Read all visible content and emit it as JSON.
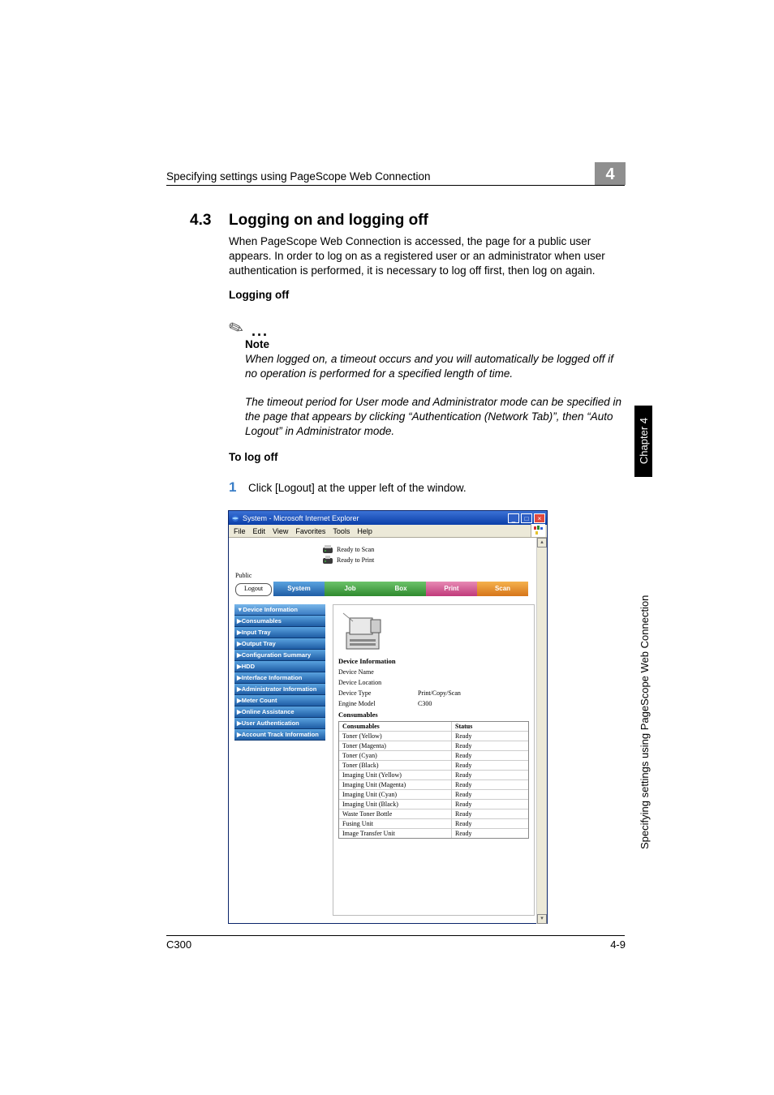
{
  "header": {
    "running_head": "Specifying settings using PageScope Web Connection",
    "chapter_badge": "4"
  },
  "section": {
    "number": "4.3",
    "title": "Logging on and logging off",
    "intro": "When PageScope Web Connection is accessed, the page for a public user appears. In order to log on as a registered user or an administrator when user authentication is performed, it is necessary to log off first, then log on again.",
    "sub1": "Logging off",
    "note_label": "Note",
    "note1": "When logged on, a timeout occurs and you will automatically be logged off if no operation is performed for a specified length of time.",
    "note2": "The timeout period for User mode and Administrator mode can be specified in the page that appears by clicking “Authentication (Network Tab)”, then “Auto Logout” in Administrator mode.",
    "sub2": "To log off",
    "step_num": "1",
    "step_text": "Click [Logout] at the upper left of the window."
  },
  "window": {
    "title": "System - Microsoft Internet Explorer",
    "menu": [
      "File",
      "Edit",
      "View",
      "Favorites",
      "Tools",
      "Help"
    ],
    "status1": "Ready to Scan",
    "status2": "Ready to Print",
    "public": "Public",
    "logout": "Logout",
    "tabs": {
      "system": "System",
      "job": "Job",
      "box": "Box",
      "print": "Print",
      "scan": "Scan"
    },
    "nav": [
      "▼Device Information",
      "▶Consumables",
      "▶Input Tray",
      "▶Output Tray",
      "▶Configuration Summary",
      "▶HDD",
      "▶Interface Information",
      "▶Administrator Information",
      "▶Meter Count",
      "▶Online Assistance",
      "▶User Authentication",
      "▶Account Track Information"
    ],
    "panel": {
      "title": "Device Information",
      "rows": [
        {
          "k": "Device Name",
          "v": ""
        },
        {
          "k": "Device Location",
          "v": ""
        },
        {
          "k": "Device Type",
          "v": "Print/Copy/Scan"
        },
        {
          "k": "Engine Model",
          "v": "C300"
        }
      ],
      "consumables_title": "Consumables",
      "table_head": {
        "c1": "Consumables",
        "c2": "Status"
      },
      "table": [
        {
          "c1": "Toner (Yellow)",
          "c2": "Ready"
        },
        {
          "c1": "Toner (Magenta)",
          "c2": "Ready"
        },
        {
          "c1": "Toner (Cyan)",
          "c2": "Ready"
        },
        {
          "c1": "Toner (Black)",
          "c2": "Ready"
        },
        {
          "c1": "Imaging Unit (Yellow)",
          "c2": "Ready"
        },
        {
          "c1": "Imaging Unit (Magenta)",
          "c2": "Ready"
        },
        {
          "c1": "Imaging Unit (Cyan)",
          "c2": "Ready"
        },
        {
          "c1": "Imaging Unit (Black)",
          "c2": "Ready"
        },
        {
          "c1": "Waste Toner Bottle",
          "c2": "Ready"
        },
        {
          "c1": "Fusing Unit",
          "c2": "Ready"
        },
        {
          "c1": "Image Transfer Unit",
          "c2": "Ready"
        }
      ]
    }
  },
  "side": {
    "chapter": "Chapter 4",
    "text": "Specifying settings using PageScope Web Connection"
  },
  "footer": {
    "left": "C300",
    "right": "4-9"
  }
}
